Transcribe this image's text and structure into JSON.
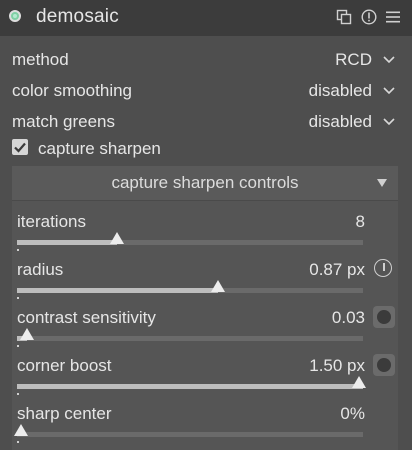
{
  "header": {
    "title": "demosaic",
    "icons": [
      "preset-copy-icon",
      "info-reset-icon",
      "menu-icon"
    ]
  },
  "settings": {
    "method": {
      "label": "method",
      "value": "RCD"
    },
    "color_smoothing": {
      "label": "color smoothing",
      "value": "disabled"
    },
    "match_greens": {
      "label": "match greens",
      "value": "disabled"
    },
    "capture_sharpen": {
      "label": "capture sharpen",
      "checked": true
    }
  },
  "section": {
    "title": "capture sharpen controls",
    "sliders": [
      {
        "label": "iterations",
        "value": "8",
        "fraction": 0.29
      },
      {
        "label": "radius",
        "value": "0.87 px",
        "fraction": 0.58
      },
      {
        "label": "contrast sensitivity",
        "value": "0.03",
        "fraction": 0.03
      },
      {
        "label": "corner boost",
        "value": "1.50 px",
        "fraction": 1.0
      },
      {
        "label": "sharp center",
        "value": "0%",
        "fraction": 0.0
      }
    ]
  },
  "colors": {
    "background": "#4e4e4e",
    "header": "#3c3c3c",
    "section": "#555555",
    "track": "#6a6a6a",
    "fill": "#bdbdbd",
    "text": "#e6e6e6"
  }
}
